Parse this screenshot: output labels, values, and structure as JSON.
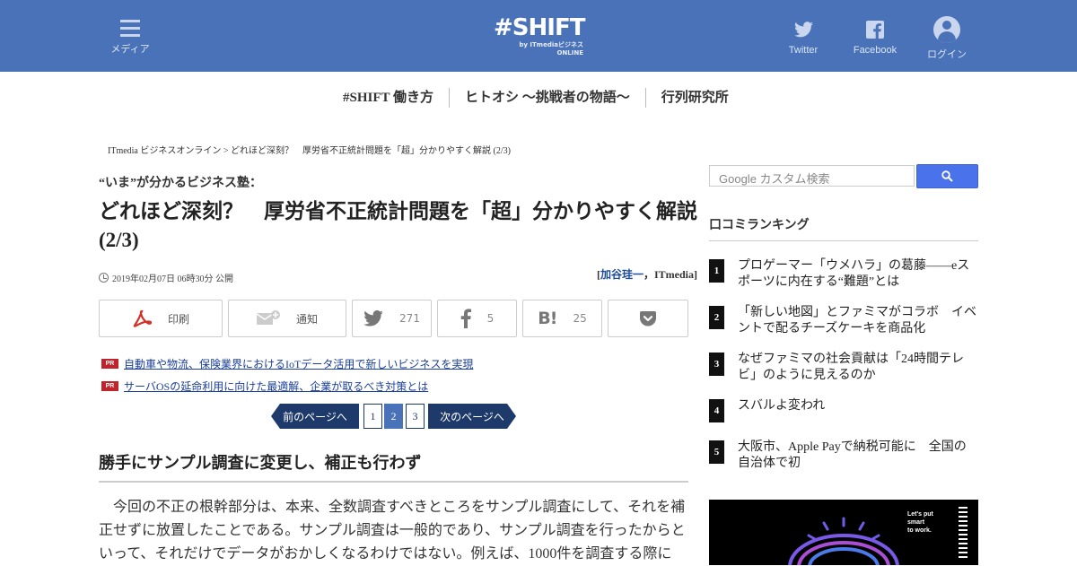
{
  "header": {
    "menu_label": "メディア",
    "logo_text": "#SHIFT",
    "logo_sub": "by ITmediaビジネス ONLINE",
    "twitter_label": "Twitter",
    "facebook_label": "Facebook",
    "login_label": "ログイン",
    "background_color": "#4a72b8"
  },
  "global_nav": [
    {
      "label": "#SHIFT 働き方"
    },
    {
      "label": "ヒトオシ ～挑戦者の物語～"
    },
    {
      "label": "行列研究所"
    }
  ],
  "breadcrumb": "ITmedia ビジネスオンライン > どれほど深刻？　厚労省不正統計問題を「超」分かりやすく解説 (2/3)",
  "article": {
    "series": "“いま”が分かるビジネス塾：",
    "title": "どれほど深刻？　厚労省不正統計問題を「超」分かりやすく解説 (2/3)",
    "date": "2019年02月07日 06時30分 公開",
    "author_open": "[",
    "author_name": "加谷珪一",
    "author_sep": "，",
    "author_org": "ITmedia",
    "author_close": "]",
    "share": {
      "print_label": "印刷",
      "notify_label": "通知",
      "twitter_count": "271",
      "facebook_count": "5",
      "hatena_count": "25"
    },
    "pr_tag": "PR",
    "pr_links": [
      "自動車や物流、保険業界におけるIoTデータ活用で新しいビジネスを実現",
      "サーバOSの延命利用に向けた最適解、企業が取るべき対策とは"
    ],
    "pager": {
      "prev_label": "前のページへ",
      "pages": [
        "1",
        "2",
        "3"
      ],
      "current_page": 2,
      "next_label": "次のページへ"
    },
    "section_heading": "勝手にサンプル調査に変更し、補正も行わず",
    "paragraph": "　今回の不正の根幹部分は、本来、全数調査すべきところをサンプル調査にして、それを補正せずに放置したことである。サンプル調査は一般的であり、サンプル調査を行ったからといって、それだけでデータがおかしくなるわけではない。例えば、1000件を調査する際に"
  },
  "sidebar": {
    "search_placeholder": "Google カスタム検索",
    "ranking_title": "口コミランキング",
    "ranking": [
      {
        "rank": "1",
        "title": "プロゲーマー「ウメハラ」の葛藤――eスポーツに内在する“難題”とは"
      },
      {
        "rank": "2",
        "title": "「新しい地図」とファミマがコラボ　イベントで配るチーズケーキを商品化"
      },
      {
        "rank": "3",
        "title": "なぜファミマの社会貢献は「24時間テレビ」のように見えるのか"
      },
      {
        "rank": "4",
        "title": "スバルよ変われ"
      },
      {
        "rank": "5",
        "title": "大阪市、Apple Payで納税可能に　全国の自治体で初"
      }
    ],
    "ad_text_1": "Let's put",
    "ad_text_2": "smart",
    "ad_text_3": "to work."
  }
}
